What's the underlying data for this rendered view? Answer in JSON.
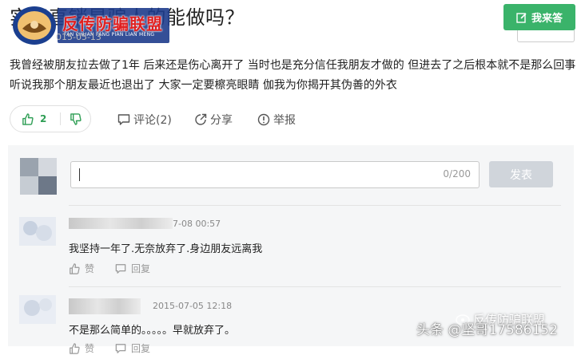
{
  "question": {
    "title": "实际直销是骗人的能做吗？",
    "date_fragment": "015-05-13",
    "answer_button": "我来答"
  },
  "logo": {
    "name": "反传防骗联盟",
    "subtitle": "FAN CHUAN FANG PIAN LIAN MENG"
  },
  "answer": {
    "text": "我曾经被朋友拉去做了1年 后来还是伤心离开了 当时也是充分信任我朋友才做的 但进去了之后根本就不是那么回事 听说我那个朋友最近也退出了 大家一定要檫亮眼睛 伽我为你揭开其伪善的外衣",
    "likes": "2",
    "comment_label": "评论(2)",
    "share_label": "分享",
    "report_label": "举报"
  },
  "comment_box": {
    "counter": "0/200",
    "post_button": "发表"
  },
  "comments": [
    {
      "date": "7-08 00:57",
      "text": "我坚持一年了.无奈放弃了.身边朋友远离我",
      "like_label": "赞",
      "reply_label": "回复"
    },
    {
      "date": "2015-07-05 12:18",
      "text": "不是那么简单的。。。。。早就放弃了。",
      "like_label": "赞",
      "reply_label": "回复"
    }
  ],
  "watermark": {
    "brand": "反传防骗联盟",
    "source": "头条 @坚哥17586152"
  },
  "colors": {
    "accent": "#3ab36a",
    "logo_red": "#e02020",
    "panel_bg": "#f5f6f7"
  }
}
